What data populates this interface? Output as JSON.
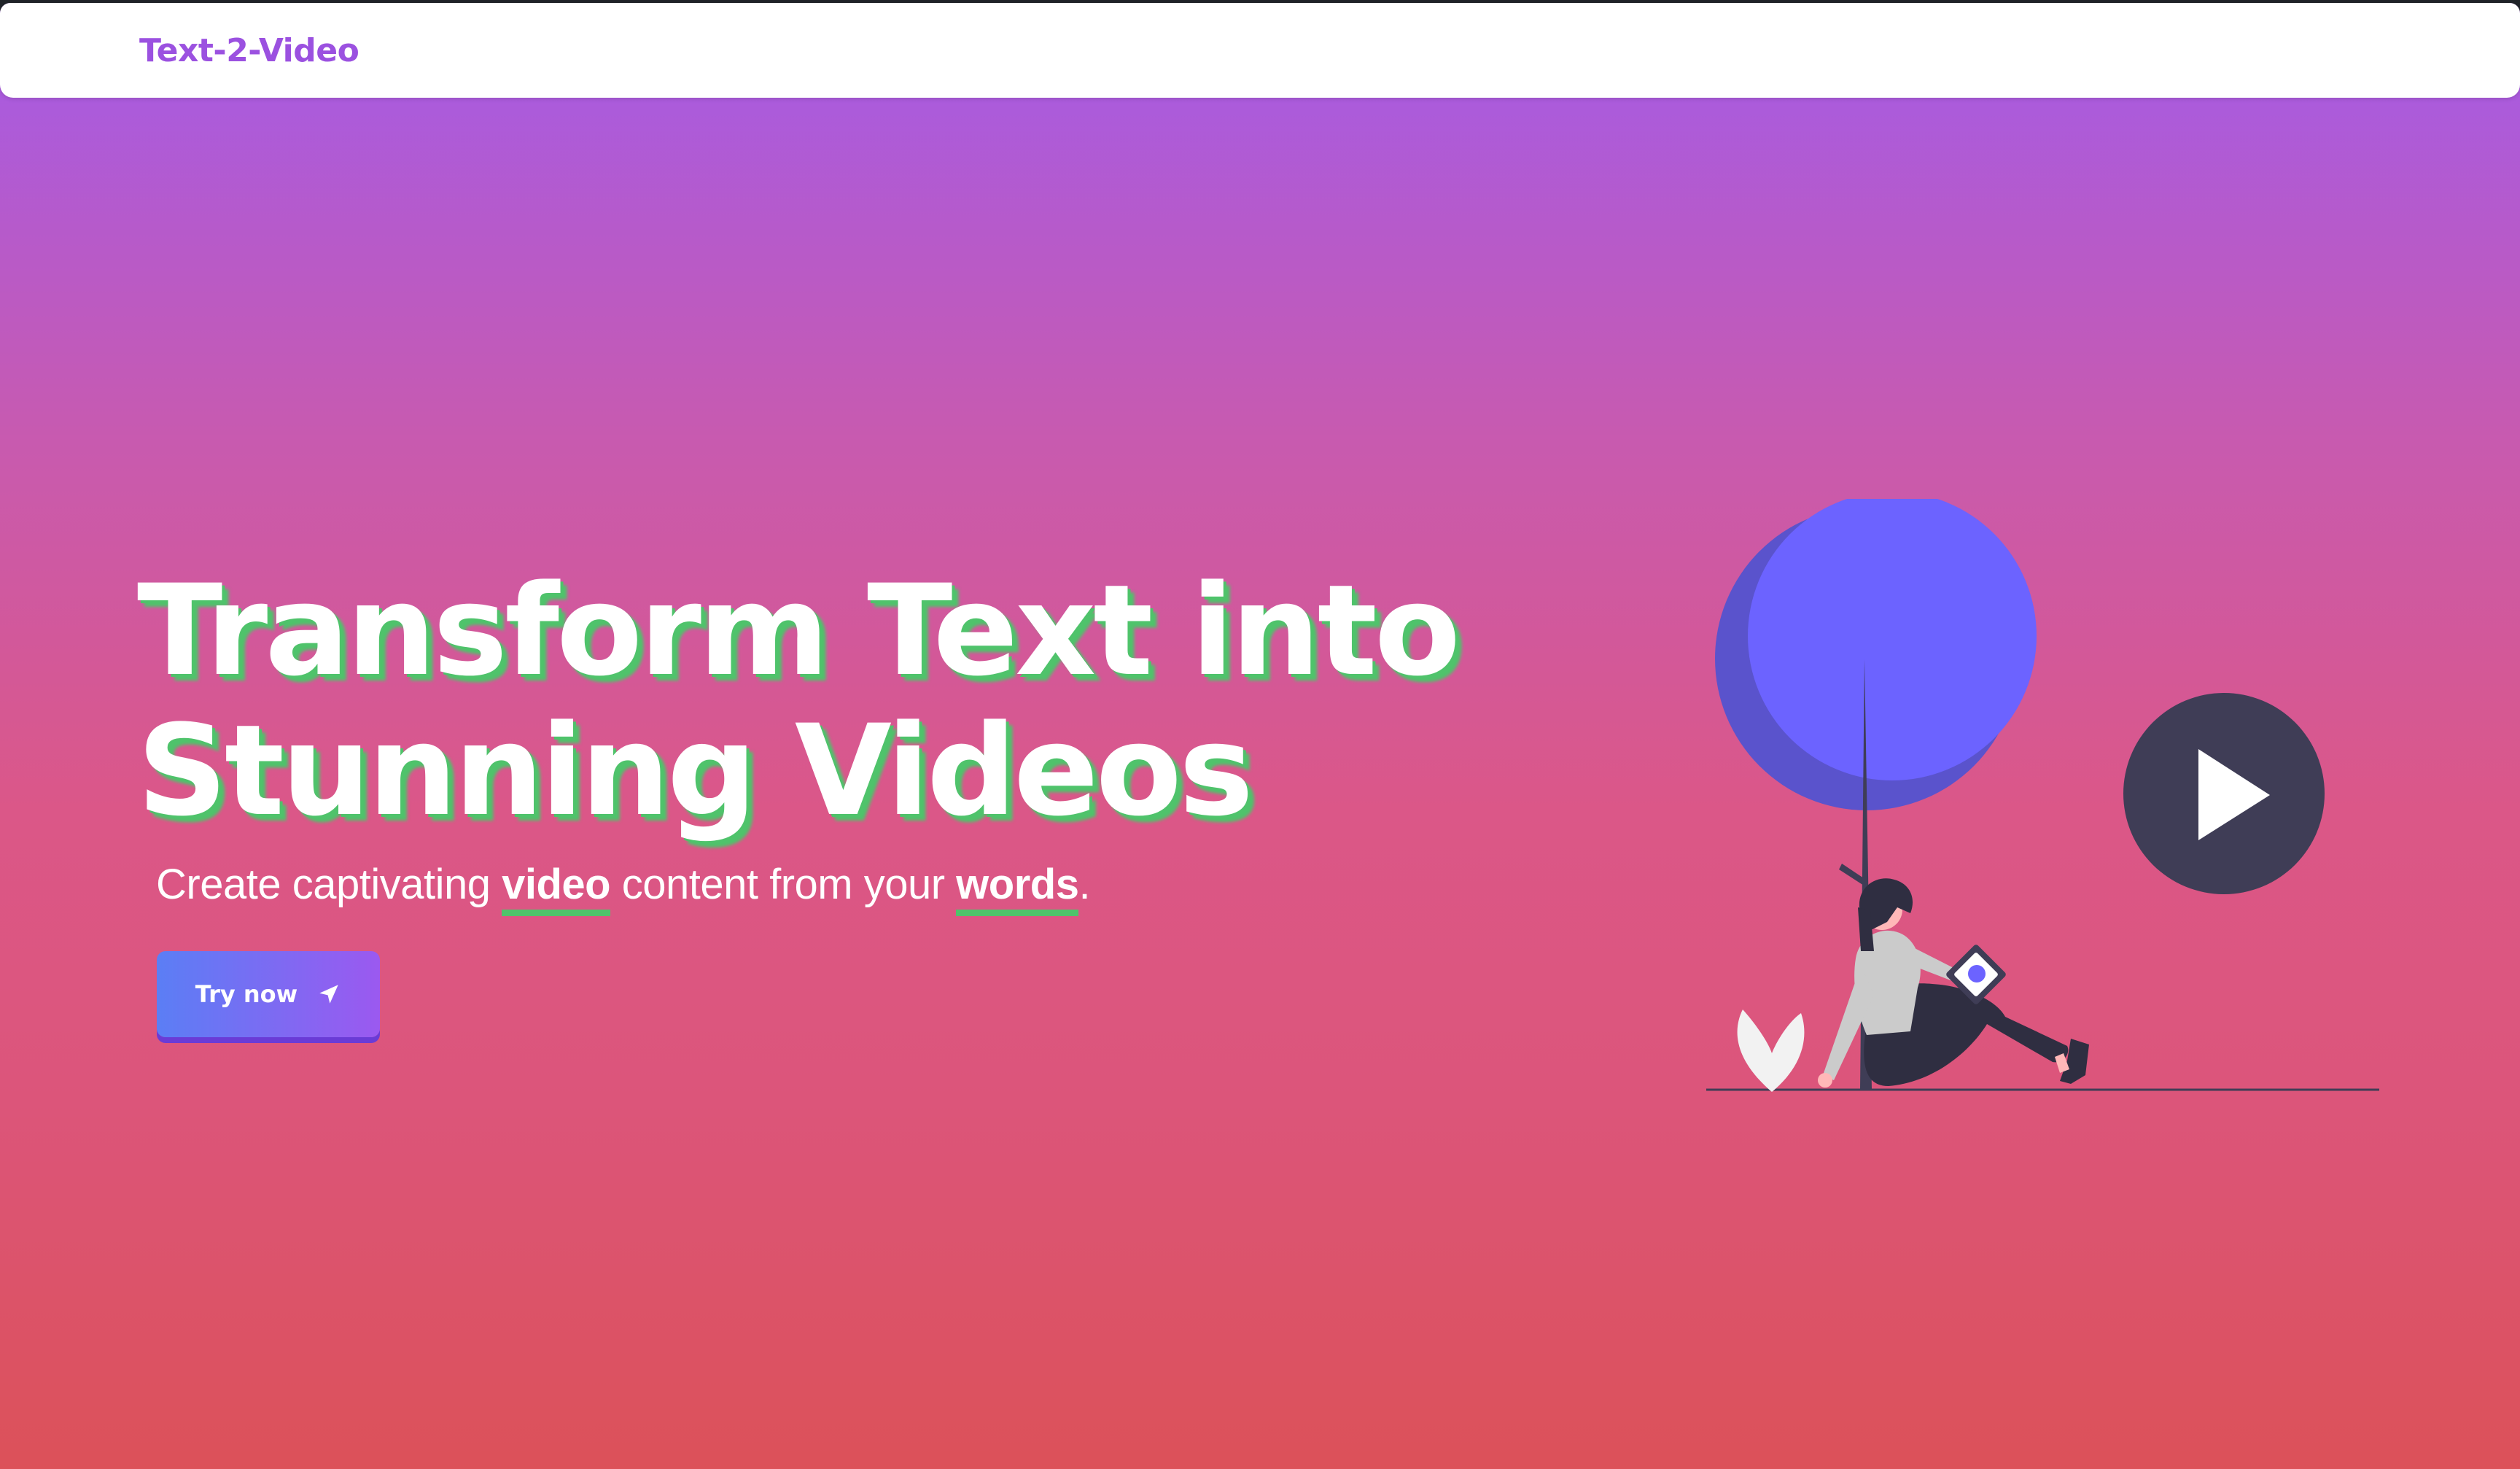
{
  "navbar": {
    "brand": "Text-2-Video"
  },
  "hero": {
    "title_line1": "Transform Text into",
    "title_line2": "Stunning Videos",
    "subtitle": {
      "part1": "Create captivating ",
      "highlight1": "video",
      "part2": " content from your ",
      "highlight2": "words",
      "part3": "."
    },
    "cta_label": "Try now",
    "cta_icon": "paper-plane-icon"
  },
  "colors": {
    "brand": "#9b51e0",
    "text_shadow": "#4fc36b",
    "button_start": "#5b7ef5",
    "button_end": "#9b59f0",
    "illustration_circle": "#6c63ff",
    "play_button": "#3f3d56"
  }
}
